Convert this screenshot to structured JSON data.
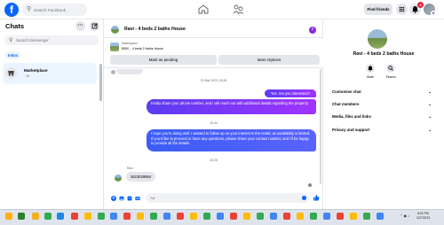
{
  "header": {
    "search_placeholder": "Search Facebook",
    "find_friends": "Find friends",
    "notif_count": "3"
  },
  "chats": {
    "title": "Chats",
    "search_placeholder": "Search Messenger",
    "inbox_label": "Inbox",
    "items": [
      {
        "name": "Marketplace",
        "time": "· 1h"
      }
    ]
  },
  "conversation": {
    "title": "Ravi - 4 beds 2 baths House",
    "marketplace_label": "Marketplace",
    "listing": "$950 – 4 beds 2 baths House",
    "mark_pending": "Mark as pending",
    "more_options": "More Options",
    "timestamps": [
      "20 Mar 2023, 15:28",
      "15:44",
      "20:25"
    ],
    "messages": [
      {
        "from": "me",
        "text": "Yes. Are you interested?"
      },
      {
        "from": "me",
        "text": "Kindly share your phone number, and I will reach out with additional details regarding the property."
      },
      {
        "from": "me",
        "text": "I hope you're doing well. I wanted to follow up on your interest in the rental, as availability is limited. If you'd like to proceed or have any questions, please share your contact number, and I'll be happy to provide all the details."
      },
      {
        "from": "Ravi",
        "sender_label": "Ravi",
        "text": "2623029984"
      }
    ],
    "composer_placeholder": "Aa"
  },
  "details": {
    "name": "Ravi - 4 beds 2 baths House",
    "actions": [
      "Mute",
      "Search"
    ],
    "sections": [
      "Customise chat",
      "Chat members",
      "Media, files and links",
      "Privacy and support"
    ]
  },
  "taskbar": {
    "time": "8:53 PM",
    "date": "3/27/2023"
  },
  "colors": {
    "facebook_blue": "#0866ff",
    "bubble_purple": "#7b2ff7",
    "bubble_blue": "#4a5ef8"
  }
}
